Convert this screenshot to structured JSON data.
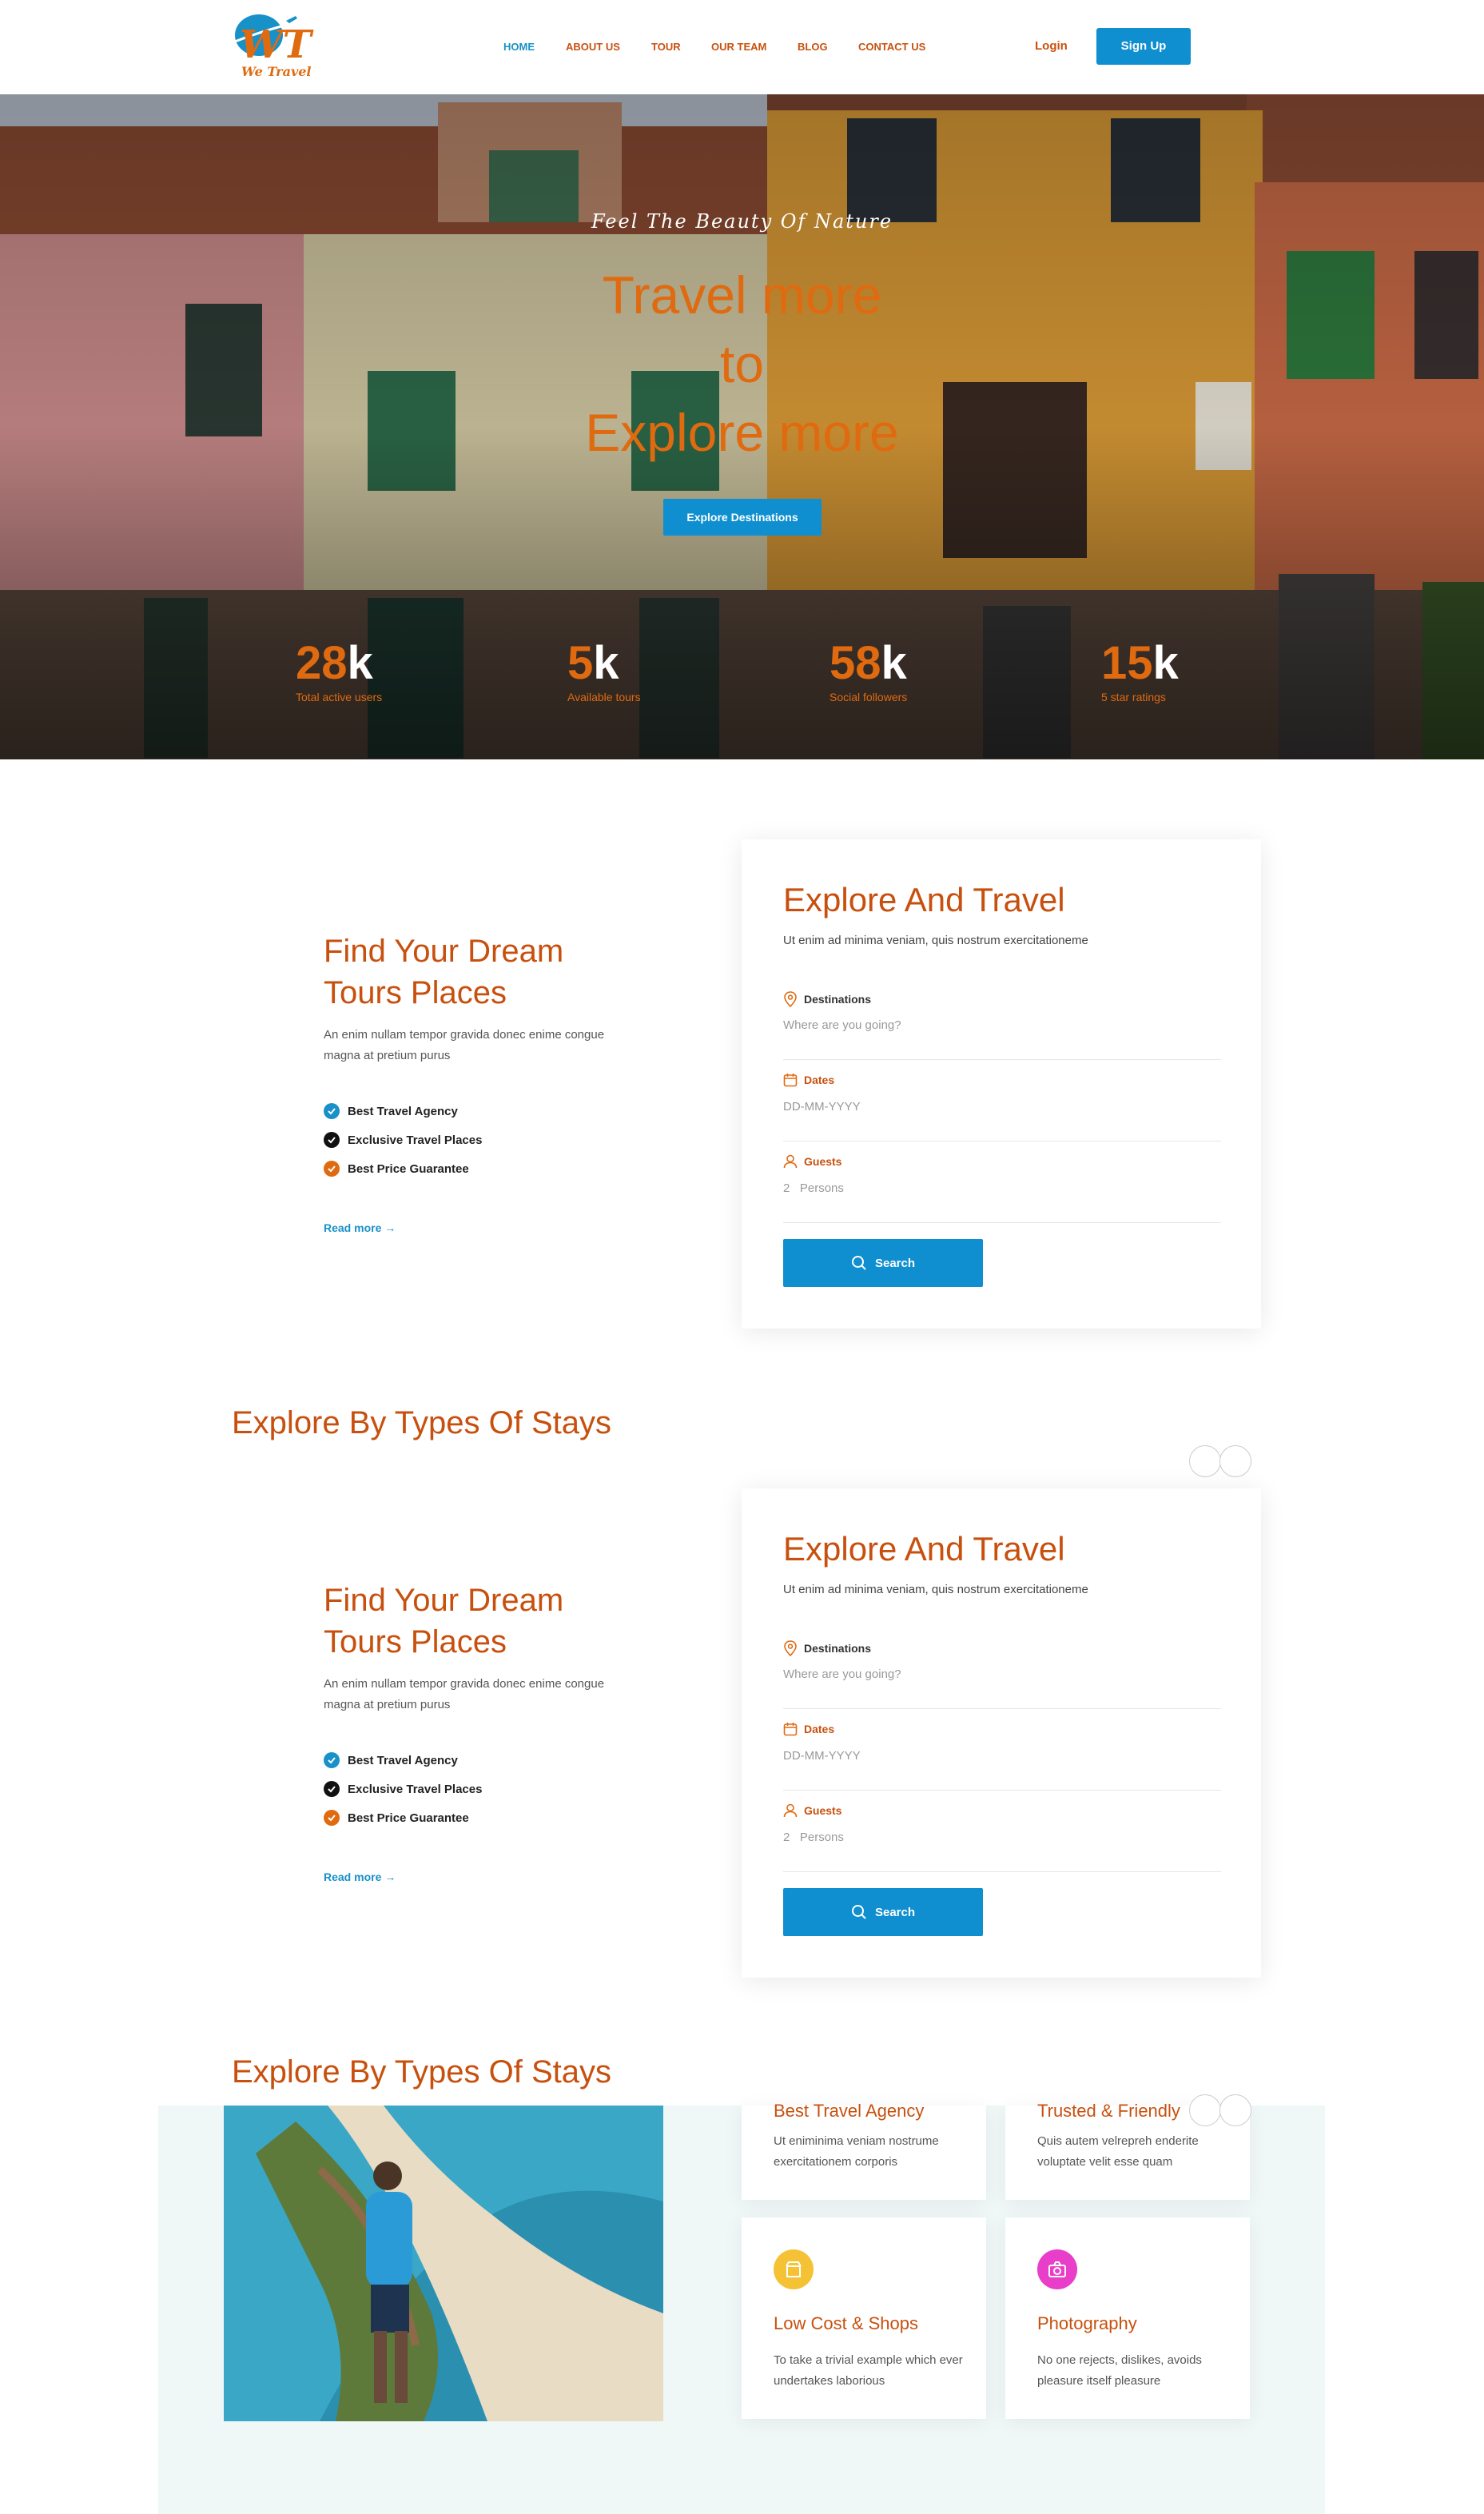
{
  "header": {
    "logo_text": "We Travel",
    "nav": [
      "HOME",
      "ABOUT US",
      "TOUR",
      "OUR TEAM",
      "BLOG",
      "CONTACT US"
    ],
    "login": "Login",
    "signup": "Sign Up"
  },
  "hero": {
    "tagline": "Feel The Beauty Of Nature",
    "title_lines": [
      "Travel more",
      "to",
      "Explore more"
    ],
    "button": "Explore Destinations",
    "stats": [
      {
        "num": "28",
        "suffix": "k",
        "label": "Total active users"
      },
      {
        "num": "5",
        "suffix": "k",
        "label": "Available tours"
      },
      {
        "num": "58",
        "suffix": "k",
        "label": "Social followers"
      },
      {
        "num": "15",
        "suffix": "k",
        "label": "5 star ratings"
      }
    ]
  },
  "find": {
    "title_line1": "Find Your Dream",
    "title_line2": "Tours Places",
    "desc_line1": "An enim nullam tempor gravida donec enime congue",
    "desc_line2": "magna at pretium purus",
    "features": [
      "Best Travel Agency",
      "Exclusive Travel Places",
      "Best Price Guarantee"
    ],
    "read_more": "Read more"
  },
  "explore_card": {
    "title": "Explore And Travel",
    "subtitle": "Ut enim ad minima veniam, quis nostrum exercitationeme",
    "destinations_label": "Destinations",
    "destinations_placeholder": "Where are you going?",
    "dates_label": "Dates",
    "dates_placeholder": "DD-MM-YYYY",
    "guests_label": "Guests",
    "guests_value": "2",
    "guests_unit": "Persons",
    "search": "Search"
  },
  "stays": {
    "title": "Explore By Types Of Stays"
  },
  "features": [
    {
      "title": "Best Travel Agency",
      "desc": "Ut eniminima veniam nostrume exercitationem corporis"
    },
    {
      "title": "Trusted & Friendly",
      "desc": "Quis autem velrepreh enderite voluptate velit esse quam"
    },
    {
      "title": "Low Cost & Shops",
      "desc": "To take a trivial example which ever undertakes laborious"
    },
    {
      "title": "Photography",
      "desc": "No one rejects, dislikes, avoids pleasure itself pleasure"
    }
  ],
  "colors": {
    "accent_orange": "#c8500e",
    "accent_blue": "#0f8fcf"
  }
}
